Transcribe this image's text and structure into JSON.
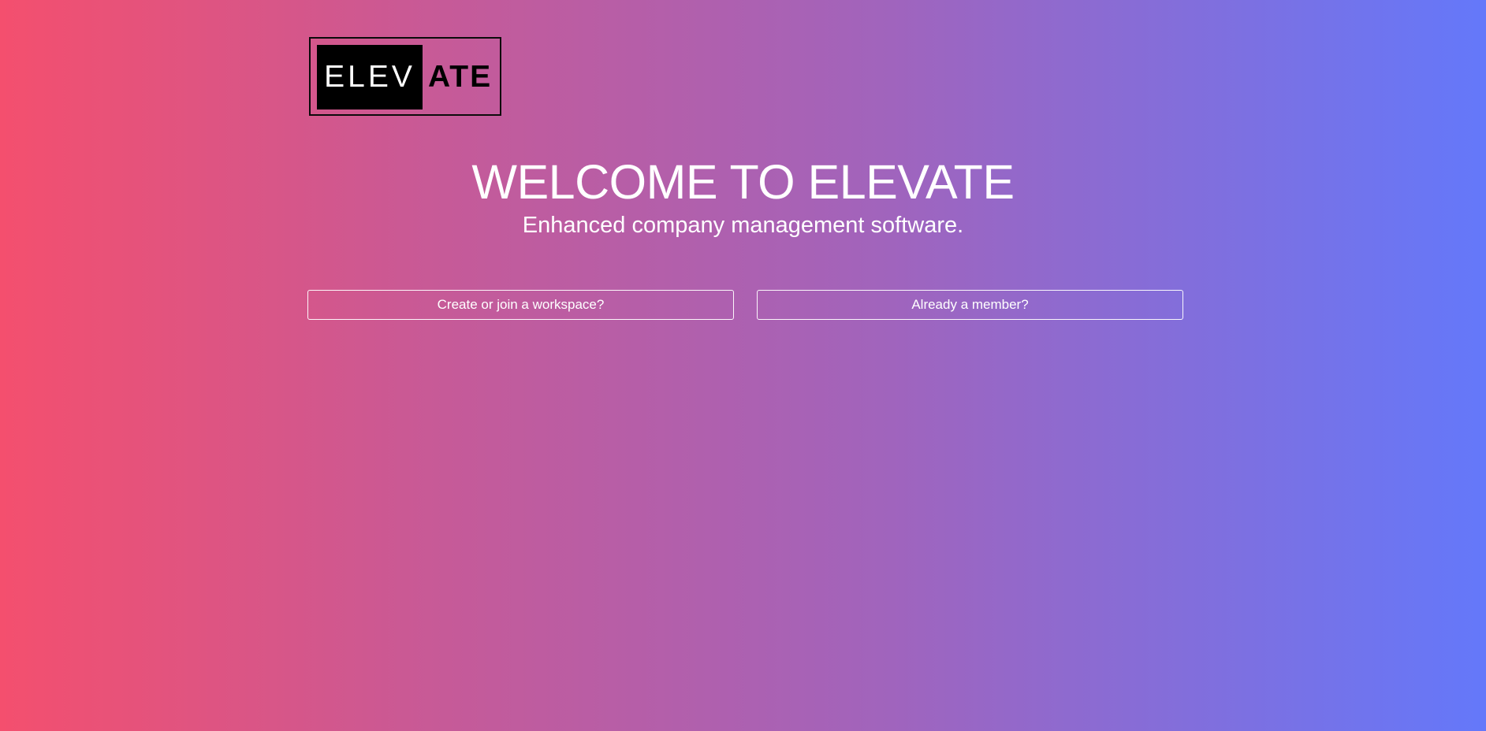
{
  "logo": {
    "part_inverted": "ELEV",
    "part_plain": "ATE"
  },
  "hero": {
    "title": "WELCOME TO ELEVATE",
    "subtitle": "Enhanced company management software."
  },
  "actions": {
    "create_join_label": "Create or join a workspace?",
    "member_label": "Already a member?"
  },
  "colors": {
    "gradient_start": "#f44f6e",
    "gradient_end": "#6478fa",
    "text": "#ffffff",
    "logo_black": "#000000"
  }
}
